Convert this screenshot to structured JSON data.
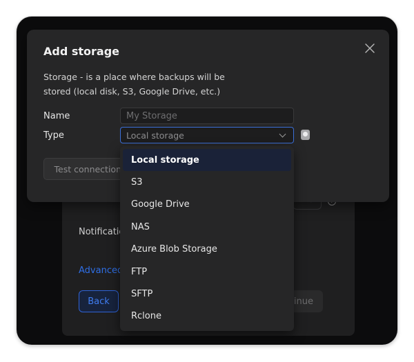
{
  "background": {
    "notifications_label": "Notificatio",
    "advanced_label": "Advanced",
    "back_label": "Back",
    "continue_label": "tinue"
  },
  "modal": {
    "title": "Add storage",
    "description": "Storage - is a place where backups will be stored (local disk, S3, Google Drive, etc.)",
    "name_label": "Name",
    "name_placeholder": "My Storage",
    "name_value": "",
    "type_label": "Type",
    "type_value": "Local storage",
    "test_connection_label": "Test connection"
  },
  "dropdown": {
    "options": [
      {
        "label": "Local storage",
        "selected": true
      },
      {
        "label": "S3"
      },
      {
        "label": "Google Drive"
      },
      {
        "label": "NAS"
      },
      {
        "label": "Azure Blob Storage"
      },
      {
        "label": "FTP"
      },
      {
        "label": "SFTP"
      },
      {
        "label": "Rclone"
      }
    ]
  },
  "colors": {
    "accent": "#3b6fd8",
    "modal_bg": "#262627",
    "window_bg": "#0c0c0d",
    "selected_option_bg": "#1a2238"
  }
}
